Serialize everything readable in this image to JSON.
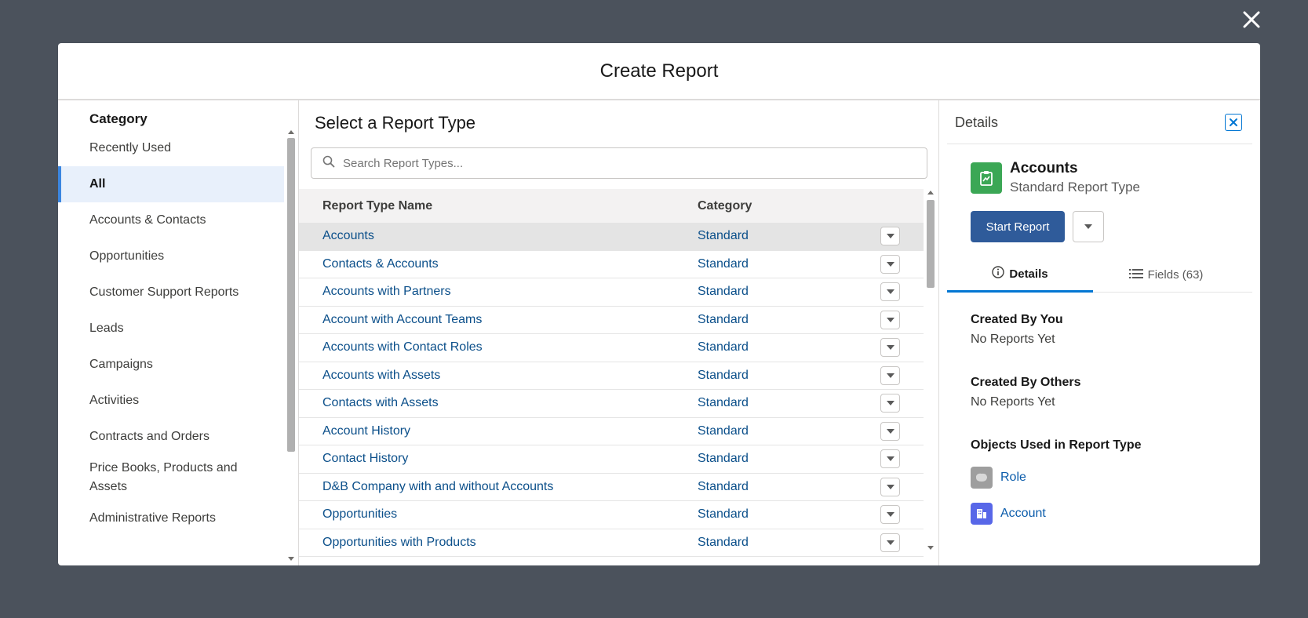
{
  "modal": {
    "title": "Create Report"
  },
  "categories": {
    "heading": "Category",
    "items": [
      {
        "label": "Recently Used",
        "selected": false
      },
      {
        "label": "All",
        "selected": true
      },
      {
        "label": "Accounts & Contacts",
        "selected": false
      },
      {
        "label": "Opportunities",
        "selected": false
      },
      {
        "label": "Customer Support Reports",
        "selected": false
      },
      {
        "label": "Leads",
        "selected": false
      },
      {
        "label": "Campaigns",
        "selected": false
      },
      {
        "label": "Activities",
        "selected": false
      },
      {
        "label": "Contracts and Orders",
        "selected": false
      },
      {
        "label": "Price Books, Products and Assets",
        "selected": false
      },
      {
        "label": "Administrative Reports",
        "selected": false
      }
    ]
  },
  "report_types": {
    "title": "Select a Report Type",
    "search_placeholder": "Search Report Types...",
    "columns": [
      "Report Type Name",
      "Category"
    ],
    "rows": [
      {
        "name": "Accounts",
        "category": "Standard",
        "active": true
      },
      {
        "name": "Contacts & Accounts",
        "category": "Standard",
        "active": false
      },
      {
        "name": "Accounts with Partners",
        "category": "Standard",
        "active": false
      },
      {
        "name": "Account with Account Teams",
        "category": "Standard",
        "active": false
      },
      {
        "name": "Accounts with Contact Roles",
        "category": "Standard",
        "active": false
      },
      {
        "name": "Accounts with Assets",
        "category": "Standard",
        "active": false
      },
      {
        "name": "Contacts with Assets",
        "category": "Standard",
        "active": false
      },
      {
        "name": "Account History",
        "category": "Standard",
        "active": false
      },
      {
        "name": "Contact History",
        "category": "Standard",
        "active": false
      },
      {
        "name": "D&B Company with and without Accounts",
        "category": "Standard",
        "active": false
      },
      {
        "name": "Opportunities",
        "category": "Standard",
        "active": false
      },
      {
        "name": "Opportunities with Products",
        "category": "Standard",
        "active": false
      }
    ]
  },
  "details": {
    "title": "Details",
    "report_type_name": "Accounts",
    "report_type_sub": "Standard Report Type",
    "start_button": "Start Report",
    "tabs": {
      "details": "Details",
      "fields": "Fields (63)"
    },
    "created_by_you": {
      "heading": "Created By You",
      "value": "No Reports Yet"
    },
    "created_by_others": {
      "heading": "Created By Others",
      "value": "No Reports Yet"
    },
    "objects_heading": "Objects Used in Report Type",
    "objects": [
      {
        "label": "Role",
        "color": "#9e9e9e"
      },
      {
        "label": "Account",
        "color": "#5867e8"
      }
    ]
  },
  "colors": {
    "backdrop": "#4b525c",
    "brand_button": "#2f5b9a",
    "selected_accent": "#3b86e0",
    "link": "#0b4f8a",
    "report_icon_bg": "#3ba755"
  }
}
